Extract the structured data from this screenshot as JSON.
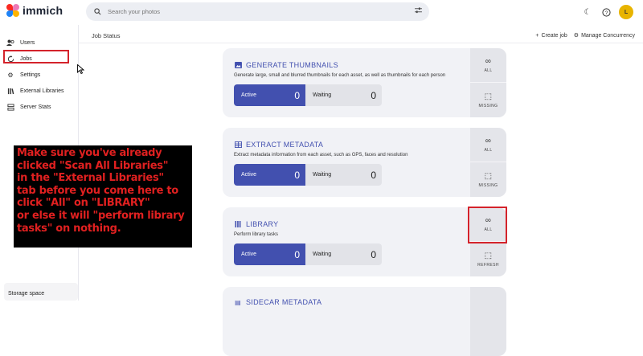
{
  "app": {
    "brand": "immich"
  },
  "search": {
    "placeholder": "Search your photos"
  },
  "sidebar": {
    "items": [
      {
        "label": "Users",
        "icon": "users-icon"
      },
      {
        "label": "Jobs",
        "icon": "sync-icon"
      },
      {
        "label": "Settings",
        "icon": "gear-icon"
      },
      {
        "label": "External Libraries",
        "icon": "library-icon"
      },
      {
        "label": "Server Stats",
        "icon": "server-icon"
      }
    ],
    "storage_label": "Storage space"
  },
  "header": {
    "title": "Job Status",
    "create_job": "Create job",
    "manage_concurrency": "Manage Concurrency"
  },
  "jobs": [
    {
      "title": "GENERATE THUMBNAILS",
      "description": "Generate large, small and blurred thumbnails for each asset, as well as thumbnails for each person",
      "active_label": "Active",
      "active": "0",
      "waiting_label": "Waiting",
      "waiting": "0",
      "btn_top": "ALL",
      "btn_bottom": "MISSING"
    },
    {
      "title": "EXTRACT METADATA",
      "description": "Extract metadata information from each asset, such as GPS, faces and resolution",
      "active_label": "Active",
      "active": "0",
      "waiting_label": "Waiting",
      "waiting": "0",
      "btn_top": "ALL",
      "btn_bottom": "MISSING"
    },
    {
      "title": "LIBRARY",
      "description": "Perform library tasks",
      "active_label": "Active",
      "active": "0",
      "waiting_label": "Waiting",
      "waiting": "0",
      "btn_top": "ALL",
      "btn_bottom": "REFRESH"
    },
    {
      "title": "SIDECAR METADATA"
    }
  ],
  "annotation": {
    "lines": [
      "Make sure you've already",
      "clicked \"Scan All Libraries\"",
      "in the \"External Libraries\"",
      "tab before you come here to",
      "click \"All\" on \"LIBRARY\"",
      "or else it will \"perform library",
      "tasks\" on nothing."
    ]
  },
  "colors": {
    "accent": "#4250af",
    "highlight": "#d4232b",
    "annotation_text": "#e02020"
  }
}
